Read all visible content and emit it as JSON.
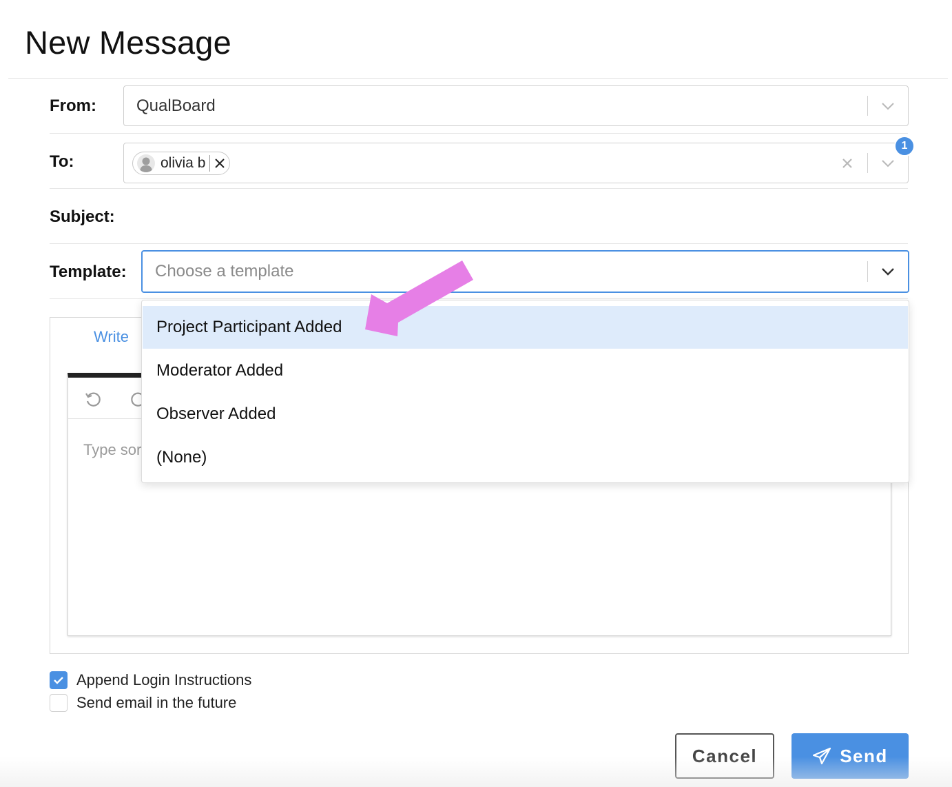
{
  "dialog": {
    "title": "New Message"
  },
  "form": {
    "from": {
      "label": "From:",
      "value": "QualBoard"
    },
    "to": {
      "label": "To:",
      "recipients": [
        {
          "name": "olivia b"
        }
      ],
      "count_badge": "1"
    },
    "subject": {
      "label": "Subject:"
    },
    "template": {
      "label": "Template:",
      "placeholder": "Choose a template",
      "dropdown_open": true,
      "options": [
        {
          "label": "Project Participant Added",
          "highlighted": true
        },
        {
          "label": "Moderator Added",
          "highlighted": false
        },
        {
          "label": "Observer Added",
          "highlighted": false
        },
        {
          "label": "(None)",
          "highlighted": false
        }
      ]
    }
  },
  "editor": {
    "tabs": [
      {
        "label": "Write",
        "active": true
      }
    ],
    "toolbar": [
      "undo-icon",
      "redo-icon"
    ],
    "placeholder": "Type sor"
  },
  "options": {
    "append_login": {
      "label": "Append Login Instructions",
      "checked": true
    },
    "send_future": {
      "label": "Send email in the future",
      "checked": false
    }
  },
  "actions": {
    "cancel_label": "Cancel",
    "send_label": "Send"
  },
  "colors": {
    "accent": "#4a90e2",
    "highlight_option": "#deebfb",
    "annotation_arrow": "#e67fe6"
  }
}
